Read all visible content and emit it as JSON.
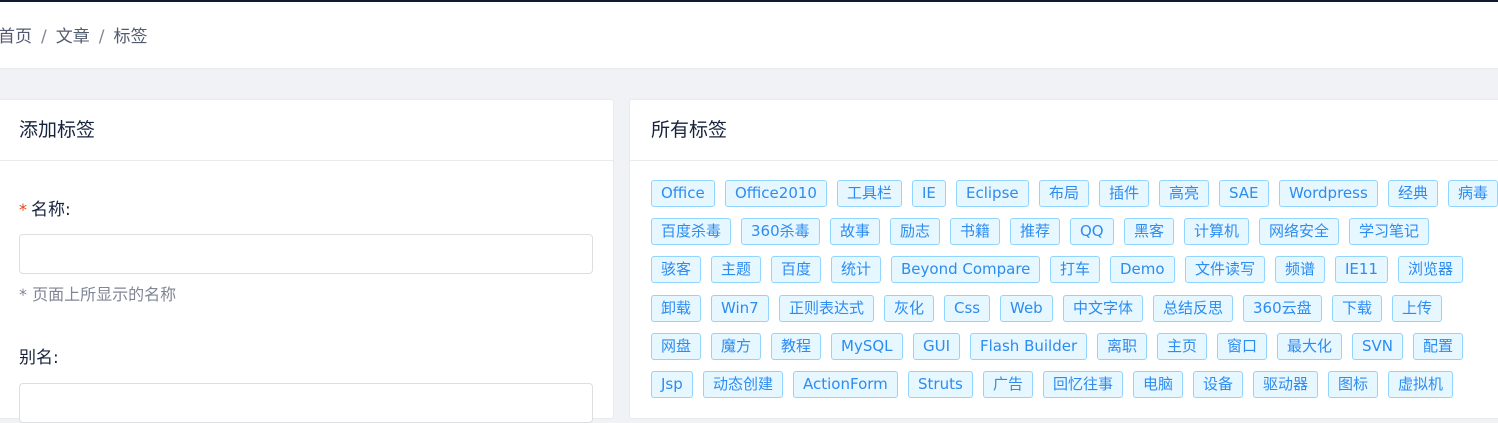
{
  "breadcrumb": {
    "home": "首页",
    "section": "文章",
    "current": "标签",
    "sep": "/"
  },
  "add_card": {
    "title": "添加标签",
    "name_label": "名称:",
    "required_mark": "*",
    "name_value": "",
    "name_hint": "* 页面上所显示的名称",
    "alias_label": "别名:",
    "alias_value": ""
  },
  "all_card": {
    "title": "所有标签",
    "tag_color": "#2d8cf0",
    "tag_bg": "#e6f7ff",
    "tag_border": "#91d5ff",
    "rows": [
      [
        "Office",
        "Office2010",
        "工具栏",
        "IE",
        "Eclipse",
        "布局",
        "插件",
        "高亮",
        "SAE",
        "Wordpress",
        "经典",
        "病毒"
      ],
      [
        "百度杀毒",
        "360杀毒",
        "故事",
        "励志",
        "书籍",
        "推荐",
        "QQ",
        "黑客",
        "计算机",
        "网络安全",
        "学习笔记"
      ],
      [
        "骇客",
        "主题",
        "百度",
        "统计",
        "Beyond Compare",
        "打车",
        "Demo",
        "文件读写",
        "频谱",
        "IE11",
        "浏览器"
      ],
      [
        "卸载",
        "Win7",
        "正则表达式",
        "灰化",
        "Css",
        "Web",
        "中文字体",
        "总结反思",
        "360云盘",
        "下载",
        "上传"
      ],
      [
        "网盘",
        "魔方",
        "教程",
        "MySQL",
        "GUI",
        "Flash Builder",
        "离职",
        "主页",
        "窗口",
        "最大化",
        "SVN",
        "配置"
      ],
      [
        "Jsp",
        "动态创建",
        "ActionForm",
        "Struts",
        "广告",
        "回忆往事",
        "电脑",
        "设备",
        "驱动器",
        "图标",
        "虚拟机"
      ]
    ]
  }
}
